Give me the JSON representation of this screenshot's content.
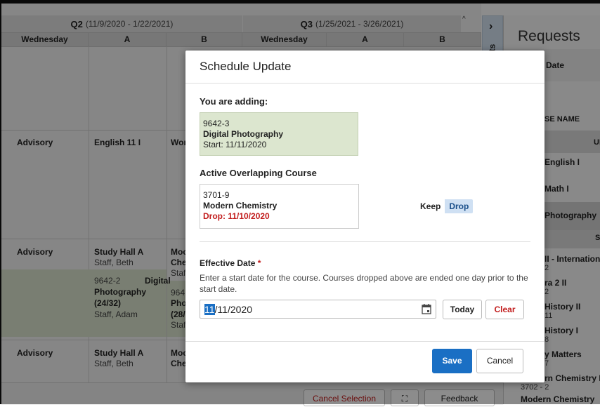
{
  "grid": {
    "q2_label": "Q2",
    "q2_dates": "(11/9/2020 - 1/22/2021)",
    "q3_label": "Q3",
    "q3_dates": "(1/25/2021 - 3/26/2021)",
    "headers": [
      "Wednesday",
      "A",
      "B",
      "Wednesday",
      "A",
      "B"
    ],
    "rows": [
      {
        "c1": "Advisory",
        "c2": "English 11 I",
        "c3": "Wor"
      },
      {
        "c1": "Advisory",
        "c2": "Study Hall A",
        "c2sub": "Staff, Beth",
        "c3": "Moc",
        "c3b": "Che",
        "c3sub": "Staf",
        "g_line1": "9642-2",
        "g_bold1": "Digital",
        "g_bold2": "Photography",
        "g_bold3": "(24/32)",
        "g_sub": "Staff, Adam",
        "g3_line1": "964",
        "g3_bold1": "Pho",
        "g3_bold2": "(28/",
        "g3_sub": "Staf"
      },
      {
        "c1": "Advisory",
        "c2": "Study Hall A",
        "c2sub": "Staff, Beth",
        "c3": "Moc",
        "c3b": "Che"
      }
    ]
  },
  "side_tab": {
    "chevron": "›",
    "label": "ts"
  },
  "requests": {
    "title": "Requests",
    "date_header": "Date",
    "course_header": "SE NAME",
    "ul": "UI",
    "s": "S",
    "items": [
      {
        "name": "English I"
      },
      {
        "name": "Math I"
      },
      {
        "name": "Photography"
      },
      {
        "name": "II - Internation",
        "sub": "2"
      },
      {
        "name": "ra 2 II",
        "sub": "2"
      },
      {
        "name": "History II",
        "sub": "11"
      },
      {
        "name": "History I",
        "sub": "8"
      },
      {
        "name": "y Matters",
        "sub": "7"
      },
      {
        "name": "rn Chemistry II",
        "sub": "3702 - 2"
      },
      {
        "name": "Modern Chemistry"
      }
    ]
  },
  "bottom": {
    "cancel_selection": "Cancel Selection",
    "expand_icon": "⛶",
    "feedback": "Feedback"
  },
  "modal": {
    "title": "Schedule Update",
    "adding_label": "You are adding:",
    "adding": {
      "code": "9642-3",
      "name": "Digital Photography",
      "start": "Start: 11/11/2020"
    },
    "overlap_label": "Active Overlapping Course",
    "overlap": {
      "code": "3701-9",
      "name": "Modern Chemistry",
      "drop": "Drop: 11/10/2020"
    },
    "keep_label": "Keep",
    "drop_label": "Drop",
    "effective_label": "Effective Date",
    "required_mark": "*",
    "help_text": "Enter a start date for the course. Courses dropped above are ended one day prior to the start date.",
    "date_selected": "11",
    "date_rest": "/11/2020",
    "today_label": "Today",
    "clear_label": "Clear",
    "save_label": "Save",
    "cancel_label": "Cancel"
  },
  "colors": {
    "accent_blue": "#1a6fc4",
    "drop_red": "#c21d1d",
    "adding_green": "#dce6cf"
  }
}
